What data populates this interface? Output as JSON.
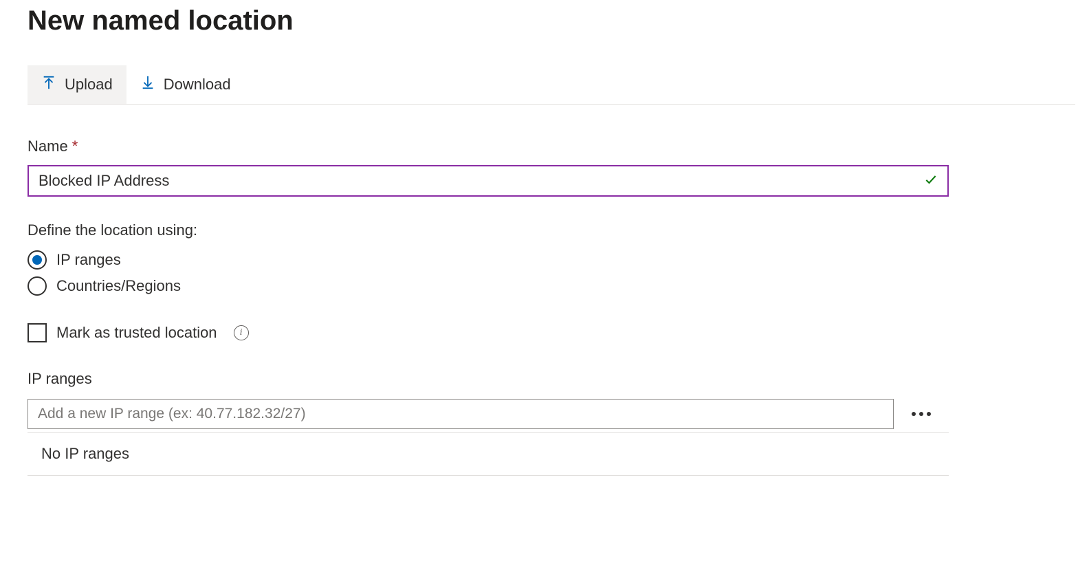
{
  "page": {
    "title": "New named location"
  },
  "toolbar": {
    "upload_label": "Upload",
    "download_label": "Download"
  },
  "form": {
    "name_label": "Name",
    "name_value": "Blocked IP Address",
    "define_label": "Define the location using:",
    "radio_ip": "IP ranges",
    "radio_countries": "Countries/Regions",
    "trusted_label": "Mark as trusted location",
    "ip_section_label": "IP ranges",
    "ip_placeholder": "Add a new IP range (ex: 40.77.182.32/27)",
    "ip_empty": "No IP ranges"
  }
}
